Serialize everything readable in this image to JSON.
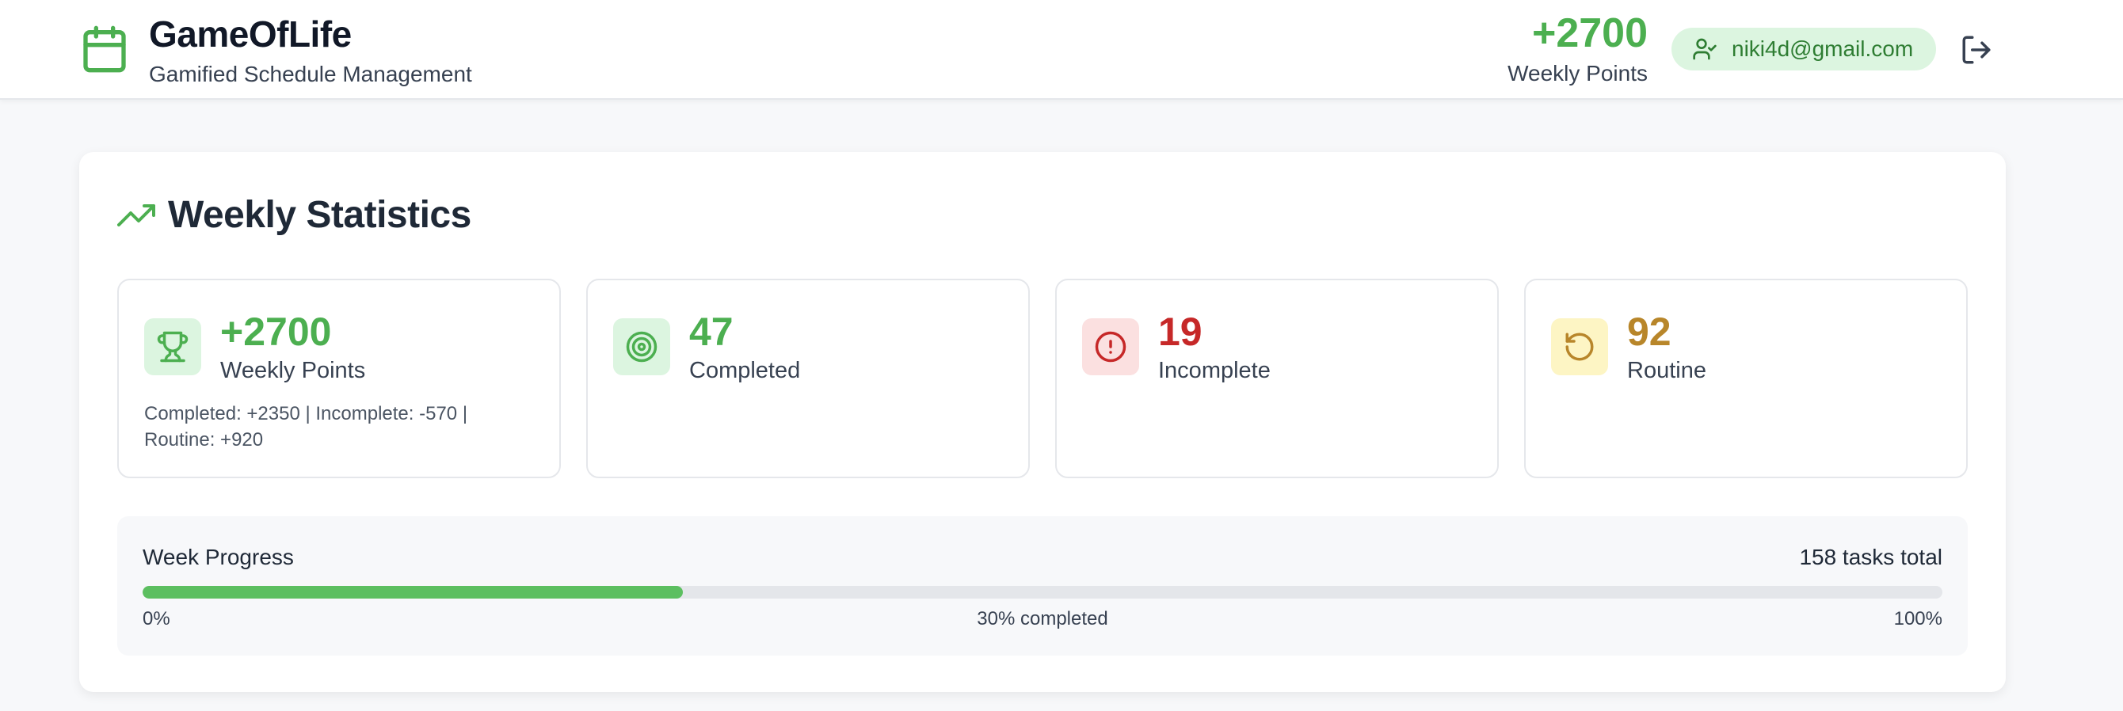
{
  "header": {
    "title": "GameOfLife",
    "subtitle": "Gamified Schedule Management",
    "points_value": "+2700",
    "points_label": "Weekly Points",
    "user_email": "niki4d@gmail.com",
    "brand_icon": "calendar-icon",
    "logout_icon": "logout-icon"
  },
  "stats_section": {
    "title": "Weekly Statistics",
    "icon": "trending-up-icon",
    "cards": [
      {
        "value": "+2700",
        "label": "Weekly Points",
        "detail": "Completed: +2350 | Incomplete: -570 | Routine: +920",
        "icon": "trophy-icon",
        "color": "#4caf50",
        "bg": "#dcf5e0"
      },
      {
        "value": "47",
        "label": "Completed",
        "icon": "target-icon",
        "color": "#4caf50",
        "bg": "#dcf5e0"
      },
      {
        "value": "19",
        "label": "Incomplete",
        "icon": "alert-circle-icon",
        "color": "#c62828",
        "bg": "#fbe0e0"
      },
      {
        "value": "92",
        "label": "Routine",
        "icon": "rotate-ccw-icon",
        "color": "#b8862a",
        "bg": "#fdf5c4"
      }
    ]
  },
  "progress": {
    "label": "Week Progress",
    "total": "158 tasks total",
    "fraction": 0.3,
    "min_label": "0%",
    "center_label": "30% completed",
    "max_label": "100%"
  },
  "colors": {
    "accent": "#4caf50",
    "progress_fill": "#5cbf60"
  }
}
